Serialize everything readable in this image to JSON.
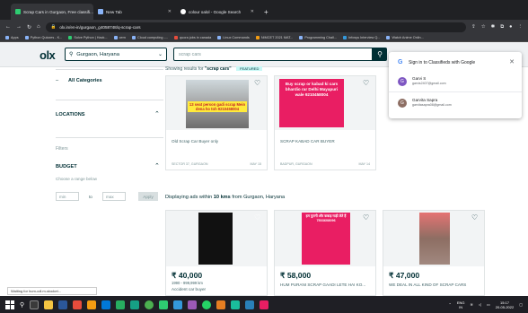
{
  "browser": {
    "tabs": [
      {
        "label": "Scrap Cars in Gurgaon, Free classifi...",
        "color": "#2ecc71",
        "active": true
      },
      {
        "label": "New Tab",
        "color": "#8ab4f8",
        "active": false
      },
      {
        "label": "colour oalol - Google Search",
        "color": "#ffffff",
        "active": false
      }
    ],
    "url": "olx.in/en-in/gurgaon_g4058748/q-scrap-cars",
    "bookmarks": [
      "Apps",
      "Python Quizzes - K...",
      "Solve Python | Hack...",
      "cern",
      "Cloud computing -...",
      "quora jobs in canada",
      "Linux Commands",
      "NIMCET 2021 MAT...",
      "Programming Chall...",
      "Infosys Interview Q...",
      "Watch Anime Onlin..."
    ]
  },
  "olx": {
    "logo": "olx",
    "location": "Gurgaon, Haryana",
    "search_value": "scrap cars"
  },
  "sidebar": {
    "all_categories": "All Categories",
    "locations": "LOCATIONS",
    "filters": "Filters",
    "budget": "BUDGET",
    "choose_range": "Choose a range below",
    "min_placeholder": "min",
    "to": "to",
    "max_placeholder": "max",
    "apply": "Apply"
  },
  "results": {
    "showing_prefix": "Showing results for",
    "showing_query": "\"scrap cars\"",
    "featured_badge": "FEATURED",
    "within_prefix": "Displaying ads within",
    "within_km": "10 kms",
    "within_suffix": "from Gurgaon, Haryana"
  },
  "featured_cards": [
    {
      "title": "Old Scrap Car Buyer only",
      "location": "SECTOR 37, GURGAON",
      "date": "MAY 15",
      "img_text": "13 seat person gadi scrap Mein dena ho toh 9210458004"
    },
    {
      "title": "SCRAP KABAD CAR BUYER",
      "location": "BADPUR, GURGAON",
      "date": "MAY 14",
      "img_text": "Buy scrap or kabad ki cars bhardio rar Delhi Mayapuri wale 9210458004"
    }
  ],
  "listing_cards": [
    {
      "price": "₹ 40,000",
      "subtitle": "1990 - 999,999 km",
      "title": "Accident car buyer"
    },
    {
      "price": "₹ 58,000",
      "title": "HUM PURANI SCRAP GAADI LETE HAI KO...",
      "img_text": "हम पुरानी और कबाड़ गाड़ी लेते हैं 7503608096"
    },
    {
      "price": "₹ 47,000",
      "title": "WE DEAL IN ALL KIND OF SCRAP CARS"
    }
  ],
  "google_popup": {
    "title": "Sign in to Classifieds with Google",
    "accounts": [
      {
        "initial": "G",
        "name": "Garvi S",
        "email": "garvis2407@gmail.com",
        "color": "#7e57c2"
      },
      {
        "initial": "G",
        "name": "Garvita Sapra",
        "email": "garvitasapra08@gmail.com",
        "color": "#8d6e63"
      }
    ]
  },
  "status_bar": "Waiting for hum-cdl.m-stocket...",
  "taskbar": {
    "lang": "ENG",
    "region": "IN",
    "time": "15:17",
    "date": "20-05-2022"
  }
}
